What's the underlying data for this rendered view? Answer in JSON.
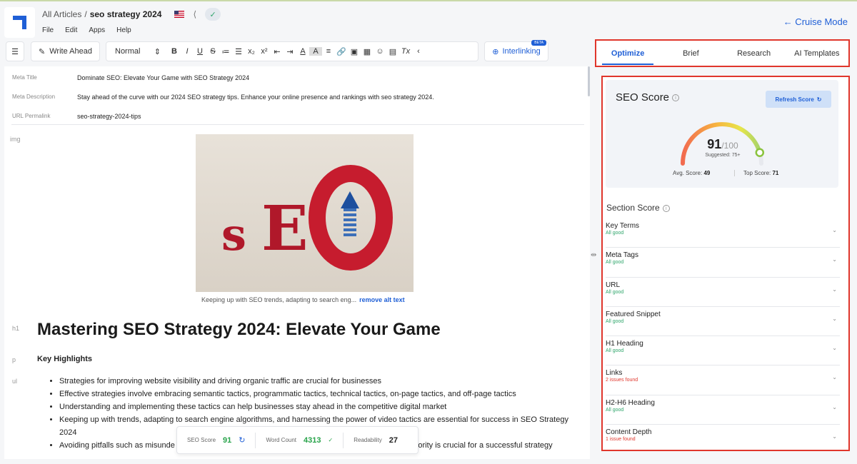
{
  "header": {
    "breadcrumb_root": "All Articles",
    "breadcrumb_sep": "/",
    "breadcrumb_current": "seo strategy 2024",
    "menu": [
      "File",
      "Edit",
      "Apps",
      "Help"
    ],
    "cruise_mode": "← Cruise Mode"
  },
  "toolbar": {
    "write_ahead": "Write Ahead",
    "style_select": "Normal",
    "format_glyphs": [
      "B",
      "I",
      "U",
      "S",
      "≔",
      "☰",
      "x₂",
      "x²",
      "⇤",
      "⇥",
      "A",
      "A",
      "≡",
      "🔗",
      "▣",
      "▦",
      "☺",
      "▤",
      "Tx",
      "‹"
    ],
    "interlinking": "Interlinking",
    "beta_badge": "BETA"
  },
  "meta": {
    "title_label": "Meta Title",
    "title_value": "Dominate SEO: Elevate Your Game with SEO Strategy 2024",
    "description_label": "Meta Description",
    "description_value": "Stay ahead of the curve with our 2024 SEO strategy tips. Enhance your online presence and rankings with seo strategy 2024.",
    "url_label": "URL Permalink",
    "url_value": "seo-strategy-2024-tips"
  },
  "content": {
    "gutter_img": "img",
    "gutter_h1": "h1",
    "gutter_p": "p",
    "gutter_ul": "ul",
    "image_caption": "Keeping up with SEO trends, adapting to search eng...",
    "remove_alt": "remove alt text",
    "h1": "Mastering SEO Strategy 2024: Elevate Your Game",
    "key_highlights": "Key Highlights",
    "bullets": [
      "Strategies for improving website visibility and driving organic traffic are crucial for businesses",
      "Effective strategies involve embracing semantic tactics, programmatic tactics, technical tactics, on-page tactics, and off-page tactics",
      "Understanding and implementing these tactics can help businesses stay ahead in the competitive digital market",
      "Keeping up with trends, adapting to search engine algorithms, and harnessing the power of video tactics are essential for success in SEO Strategy 2024",
      "Avoiding pitfalls such as misunde                                                         and failing to focus on topical authority is crucial for a successful strategy"
    ]
  },
  "stats_bar": {
    "seo_label": "SEO Score",
    "seo_value": "91",
    "word_label": "Word Count",
    "word_value": "4313",
    "readability_label": "Readability",
    "readability_value": "27"
  },
  "tabs": [
    "Optimize",
    "Brief",
    "Research",
    "AI Templates"
  ],
  "seo_panel": {
    "title": "SEO Score",
    "refresh": "Refresh Score",
    "score": "91",
    "max": "/100",
    "score_fraction": 0.91,
    "suggested": "Suggested: 75+",
    "avg_label": "Avg. Score:",
    "avg_value": "49",
    "top_label": "Top Score:",
    "top_value": "71"
  },
  "section_score": {
    "title": "Section Score",
    "items": [
      {
        "name": "Key Terms",
        "status": "All good"
      },
      {
        "name": "Meta Tags",
        "status": "All good"
      },
      {
        "name": "URL",
        "status": "All good"
      },
      {
        "name": "Featured Snippet",
        "status": "All good"
      },
      {
        "name": "H1 Heading",
        "status": "All good"
      },
      {
        "name": "Links",
        "status": "2 issues found"
      },
      {
        "name": "H2-H6 Heading",
        "status": "All good"
      },
      {
        "name": "Content Depth",
        "status": "1 issue found"
      }
    ]
  }
}
